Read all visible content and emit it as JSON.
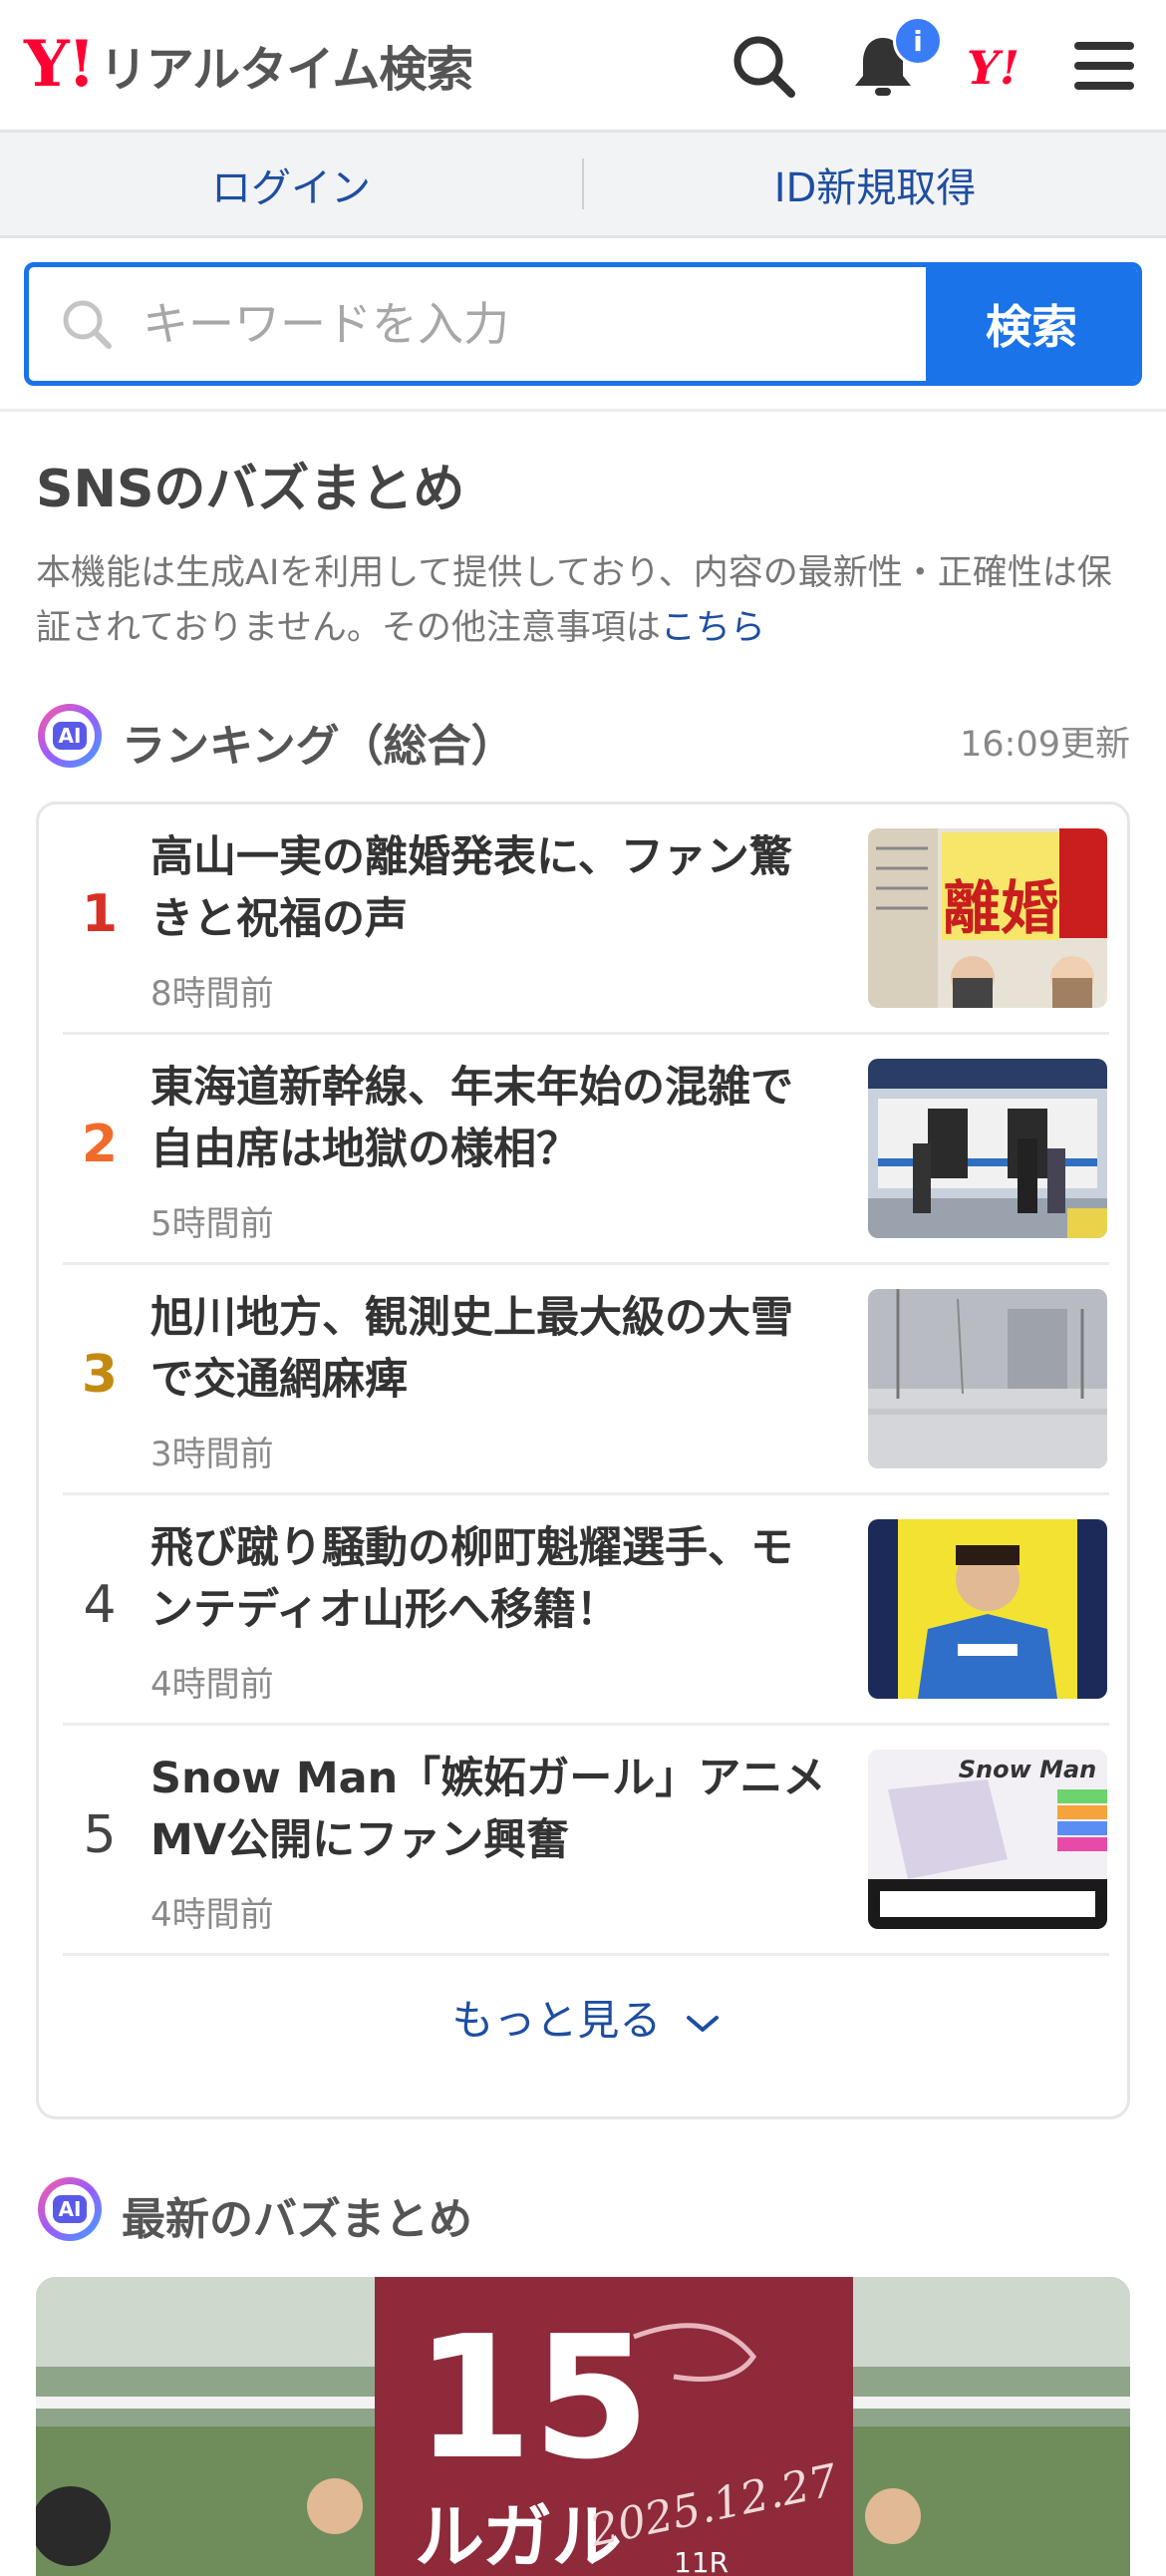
{
  "header": {
    "logo_mark": "Y!",
    "logo_text": "リアルタイム検索",
    "notification_badge": "i",
    "yj_mark": "Y!"
  },
  "auth": {
    "login_label": "ログイン",
    "signup_label": "ID新規取得"
  },
  "search": {
    "placeholder": "キーワードを入力",
    "button_label": "検索"
  },
  "section": {
    "title": "SNSのバズまとめ",
    "note_text": "本機能は生成AIを利用して提供しており、内容の最新性・正確性は保証されておりません。その他注意事項は",
    "note_link": "こちら"
  },
  "ranking": {
    "ai_label": "AI",
    "title": "ランキング（総合）",
    "updated": "16:09更新",
    "items": [
      {
        "rank": "1",
        "title": "高山一実の離婚発表に、ファン驚きと祝福の声",
        "time": "8時間前",
        "rank_color": "#d93025",
        "thumb_text": "離婚"
      },
      {
        "rank": "2",
        "title": "東海道新幹線、年末年始の混雑で自由席は地獄の様相？",
        "time": "5時間前",
        "rank_color": "#f06b2b"
      },
      {
        "rank": "3",
        "title": "旭川地方、観測史上最大級の大雪で交通網麻痺",
        "time": "3時間前",
        "rank_color": "#c38a12"
      },
      {
        "rank": "4",
        "title": "飛び蹴り騒動の柳町魁耀選手、モンテディオ山形へ移籍！",
        "time": "4時間前",
        "rank_color": "#444444"
      },
      {
        "rank": "5",
        "title": "Snow Man「嫉妬ガール」アニメMV公開にファン興奮",
        "time": "4時間前",
        "rank_color": "#444444",
        "thumb_text": "Snow Man"
      }
    ],
    "more_label": "もっと見る"
  },
  "latest": {
    "ai_label": "AI",
    "title": "最新のバズまとめ",
    "image_text_number": "15",
    "image_text_name": "ルガル",
    "image_text_date": "2025.12.27",
    "image_text_race": "11R"
  },
  "colors": {
    "brand_red": "#ff0033",
    "accent_blue": "#1a73e8",
    "link_blue": "#1e4ea1"
  }
}
